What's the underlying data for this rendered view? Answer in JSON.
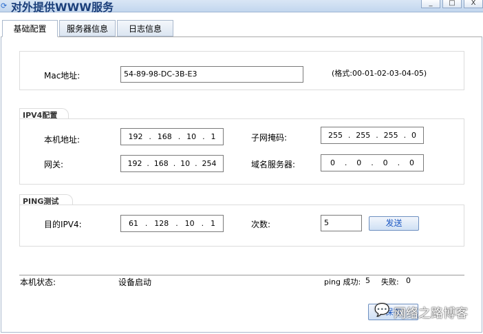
{
  "window": {
    "title": "对外提供WWW服务",
    "minimize": "_",
    "maximize": "□",
    "close": "X"
  },
  "tabs": [
    {
      "label": "基础配置",
      "active": true
    },
    {
      "label": "服务器信息"
    },
    {
      "label": "日志信息"
    }
  ],
  "mac": {
    "label": "Mac地址:",
    "value": "54-89-98-DC-3B-E3",
    "hint": "(格式:00-01-02-03-04-05)"
  },
  "ipv4": {
    "group_label": "IPV4配置",
    "local_ip": {
      "label": "本机地址:",
      "octets": [
        "192",
        "168",
        "10",
        "1"
      ]
    },
    "subnet": {
      "label": "子网掩码:",
      "octets": [
        "255",
        "255",
        "255",
        "0"
      ]
    },
    "gateway": {
      "label": "网关:",
      "octets": [
        "192",
        "168",
        "10",
        "254"
      ]
    },
    "dns": {
      "label": "域名服务器:",
      "octets": [
        "0",
        "0",
        "0",
        "0"
      ]
    }
  },
  "ping": {
    "group_label": "PING测试",
    "target": {
      "label": "目的IPV4:",
      "octets": [
        "61",
        "128",
        "10",
        "1"
      ]
    },
    "count_label": "次数:",
    "count_value": "5",
    "send_label": "发送"
  },
  "status": {
    "label": "本机状态:",
    "value": "设备启动",
    "ping_label": "ping 成功:",
    "success": "5",
    "fail_label": "失败:",
    "fail": "0"
  },
  "footer": {
    "save_label": "保存",
    "watermark": "网络之路博客"
  }
}
